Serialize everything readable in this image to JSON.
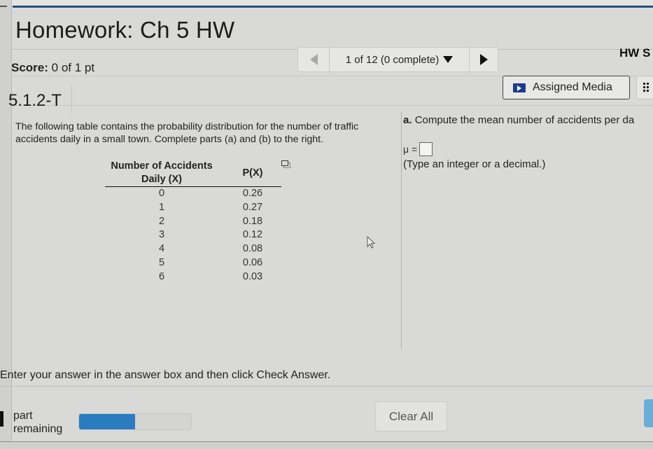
{
  "header": {
    "title": "Homework: Ch 5 HW",
    "score_label": "Score:",
    "score_value": "0 of 1 pt",
    "hw_label": "HW S"
  },
  "navigator": {
    "position_text": "1 of 12 (0 complete)"
  },
  "question": {
    "id": "5.1.2-T",
    "assigned_media_label": "Assigned Media",
    "intro": "The following table contains the probability distribution for the number of traffic accidents daily in a small town. Complete parts (a) and (b) to the right.",
    "table": {
      "headers": [
        "Number of Accidents Daily (X)",
        "P(X)"
      ],
      "rows": [
        [
          "0",
          "0.26"
        ],
        [
          "1",
          "0.27"
        ],
        [
          "2",
          "0.18"
        ],
        [
          "3",
          "0.12"
        ],
        [
          "4",
          "0.08"
        ],
        [
          "5",
          "0.06"
        ],
        [
          "6",
          "0.03"
        ]
      ]
    },
    "part_a": {
      "letter": "a.",
      "prompt": "Compute the mean number of accidents per da",
      "mu_label": "μ =",
      "answer_value": "",
      "hint": "(Type an integer or a decimal.)"
    }
  },
  "footer": {
    "instruction": "Enter your answer in the answer box and then click Check Answer.",
    "part_label_line1": "part",
    "part_label_line2": "remaining",
    "progress_fraction": 0.5,
    "clear_all_label": "Clear All"
  },
  "colors": {
    "accent_rule": "#1f4e79",
    "progress_fill": "#2a7bc0",
    "check_button": "#6aaed8"
  }
}
